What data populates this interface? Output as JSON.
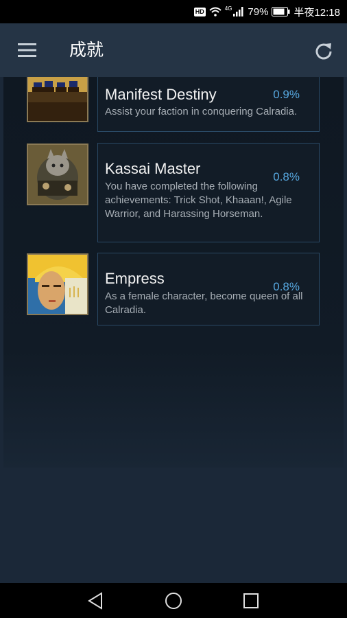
{
  "status_bar": {
    "hd": "HD",
    "network": "4G",
    "battery": "79%",
    "time": "半夜12:18"
  },
  "app_bar": {
    "title": "成就"
  },
  "achievements": [
    {
      "name": "Manifest Destiny",
      "description": "Assist your faction in conquering Calradia.",
      "percent": "0.9%"
    },
    {
      "name": "Kassai Master",
      "description": "You have completed the following achievements: Trick Shot, Khaaan!, Agile Warrior, and Harassing Horseman.",
      "percent": "0.8%"
    },
    {
      "name": "Empress",
      "description": "As a female character, become queen of all Calradia.",
      "percent": "0.8%"
    }
  ],
  "colors": {
    "app_bar": "#253445",
    "background": "#1b2838",
    "percent": "#57a8e0",
    "card_border": "#2a4a66"
  }
}
